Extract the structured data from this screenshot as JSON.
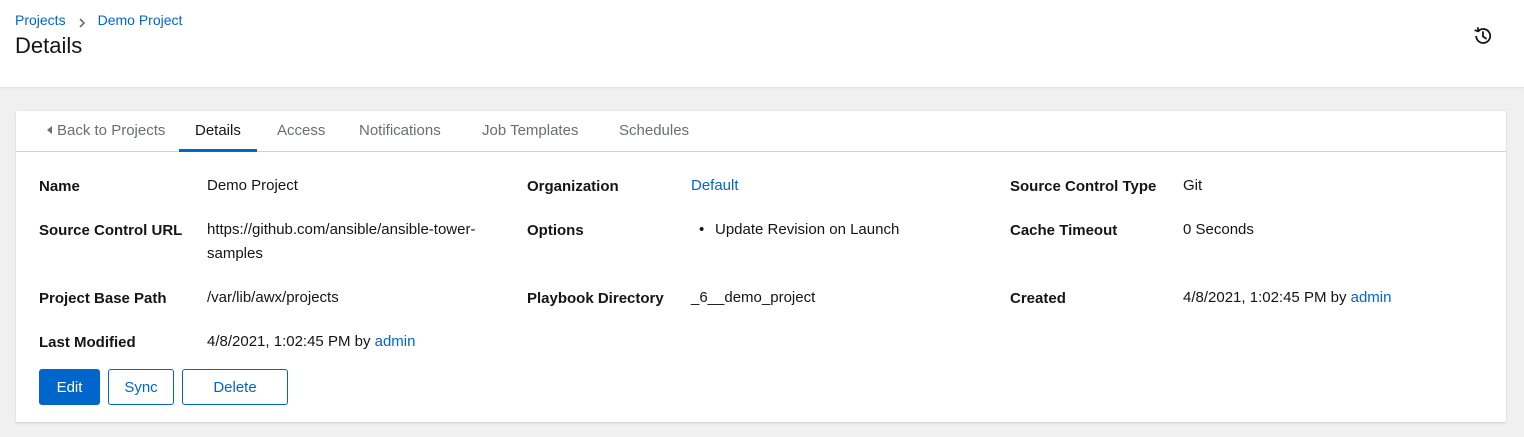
{
  "breadcrumb": {
    "root": "Projects",
    "current": "Demo Project"
  },
  "header": {
    "title": "Details",
    "history_icon": "history-icon"
  },
  "tabs": [
    {
      "label": "Back to Projects",
      "icon": "caret-left-icon"
    },
    {
      "label": "Details",
      "active": true
    },
    {
      "label": "Access"
    },
    {
      "label": "Notifications"
    },
    {
      "label": "Job Templates"
    },
    {
      "label": "Schedules"
    }
  ],
  "details": {
    "name": {
      "label": "Name",
      "value": "Demo Project"
    },
    "organization": {
      "label": "Organization",
      "value": "Default"
    },
    "source_control_type": {
      "label": "Source Control Type",
      "value": "Git"
    },
    "source_control_url": {
      "label": "Source Control URL",
      "value_line1": "https://github.com/ansible/ansible-tower-",
      "value_line2": "samples"
    },
    "options": {
      "label": "Options",
      "items": [
        "Update Revision on Launch"
      ]
    },
    "cache_timeout": {
      "label": "Cache Timeout",
      "value": "0 Seconds"
    },
    "project_base_path": {
      "label": "Project Base Path",
      "value": "/var/lib/awx/projects"
    },
    "playbook_directory": {
      "label": "Playbook Directory",
      "value": "_6__demo_project"
    },
    "created": {
      "label": "Created",
      "value": "4/8/2021, 1:02:45 PM by ",
      "user": "admin"
    },
    "last_modified": {
      "label": "Last Modified",
      "value": "4/8/2021, 1:02:45 PM by ",
      "user": "admin"
    }
  },
  "actions": {
    "edit": "Edit",
    "sync": "Sync",
    "delete": "Delete"
  },
  "colors": {
    "accent": "#0066cc",
    "page_bg": "#f0f0f0",
    "text": "#151515",
    "muted": "#6a6e73"
  }
}
